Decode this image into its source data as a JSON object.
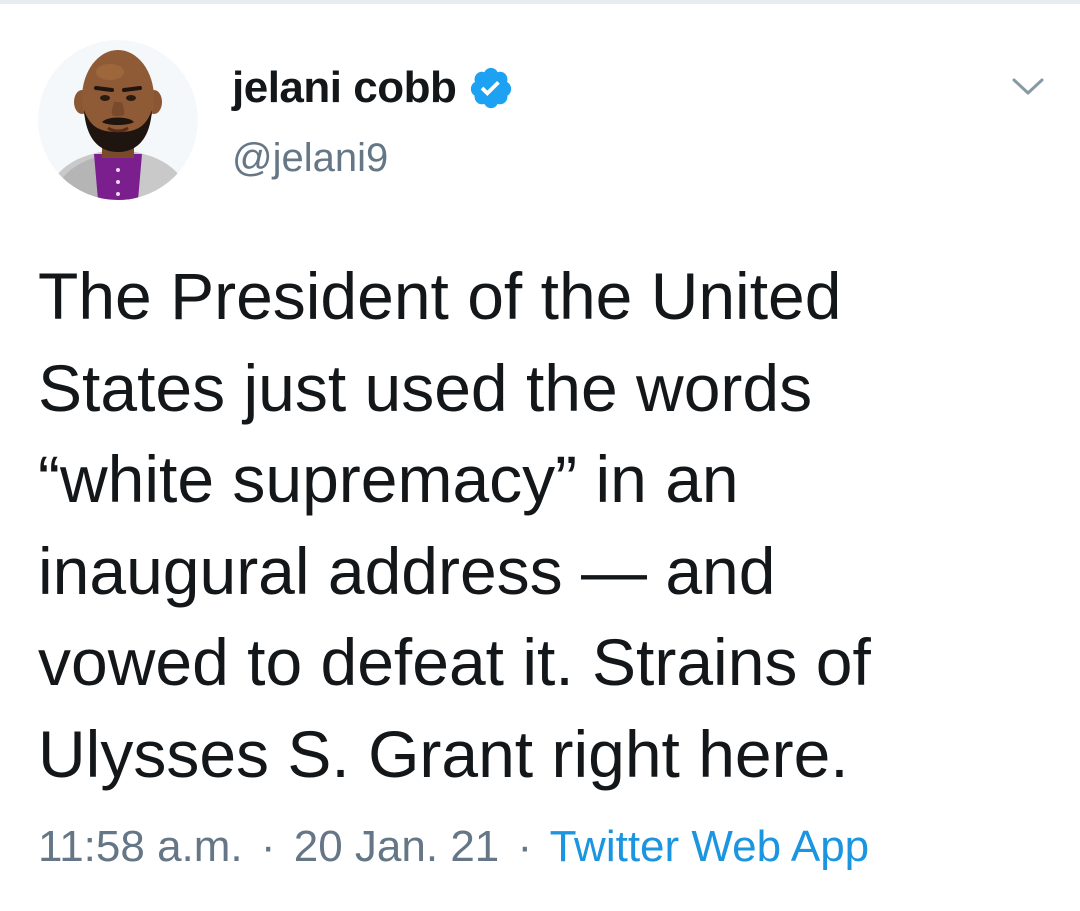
{
  "tweet": {
    "author": {
      "display_name": "jelani cobb",
      "handle": "@jelani9",
      "verified": true
    },
    "text_lines": [
      "The President of the United",
      "States just used the words",
      "“white supremacy” in an",
      "inaugural address — and",
      "vowed to defeat it. Strains of",
      "Ulysses S. Grant right here."
    ],
    "time": "11:58 a.m.",
    "date": "20 Jan. 21",
    "source": "Twitter Web App",
    "separator": "·"
  },
  "icons": {
    "avatar": "avatar-illustration",
    "verified": "verified-badge-icon",
    "menu": "chevron-down-icon"
  },
  "colors": {
    "text": "#14171a",
    "muted": "#657786",
    "link": "#1b95e0",
    "verified": "#1da1f2"
  }
}
